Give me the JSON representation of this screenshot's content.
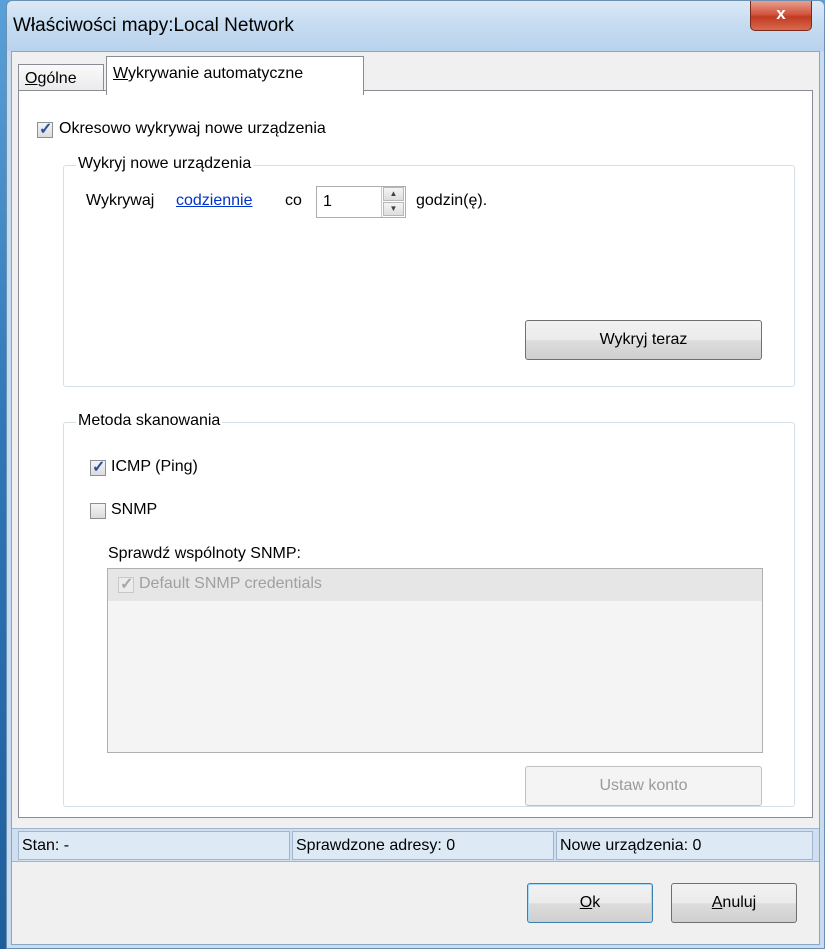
{
  "window": {
    "title": "Właściwości mapy:Local Network",
    "close_label": "x"
  },
  "tabs": [
    {
      "label": "Ogólne",
      "mnemonic": "O",
      "rest": "gólne",
      "active": false
    },
    {
      "label": "Wykrywanie automatyczne",
      "mnemonic": "W",
      "rest": "ykrywanie automatyczne",
      "active": true
    }
  ],
  "periodic": {
    "label": "Okresowo wykrywaj nowe urządzenia",
    "checked": true
  },
  "discover_group": {
    "title": "Wykryj nowe urządzenia",
    "prefix": "Wykrywaj",
    "frequency_link": "codziennie",
    "co": "co",
    "interval_value": "1",
    "unit": "godzin(ę).",
    "discover_now_label": "Wykryj teraz"
  },
  "scan_group": {
    "title": "Metoda skanowania",
    "icmp": {
      "label": "ICMP (Ping)",
      "checked": true
    },
    "snmp": {
      "label": "SNMP",
      "checked": false
    },
    "communities_label": "Sprawdź wspólnoty SNMP:",
    "communities": [
      {
        "label": "Default SNMP credentials",
        "checked": true,
        "enabled": false
      }
    ],
    "set_account_label": "Ustaw konto"
  },
  "status": {
    "state": "Stan: -",
    "checked_addresses": "Sprawdzone adresy: 0",
    "new_devices": "Nowe urządzenia: 0"
  },
  "buttons": {
    "ok_mnemonic": "O",
    "ok_rest": "k",
    "cancel_mnemonic": "A",
    "cancel_rest": "nuluj"
  },
  "colors": {
    "link": "#0033cc",
    "desktop": "#2f77b8",
    "titlebar": "#c5dbf1",
    "close_button": "#c23b22"
  }
}
